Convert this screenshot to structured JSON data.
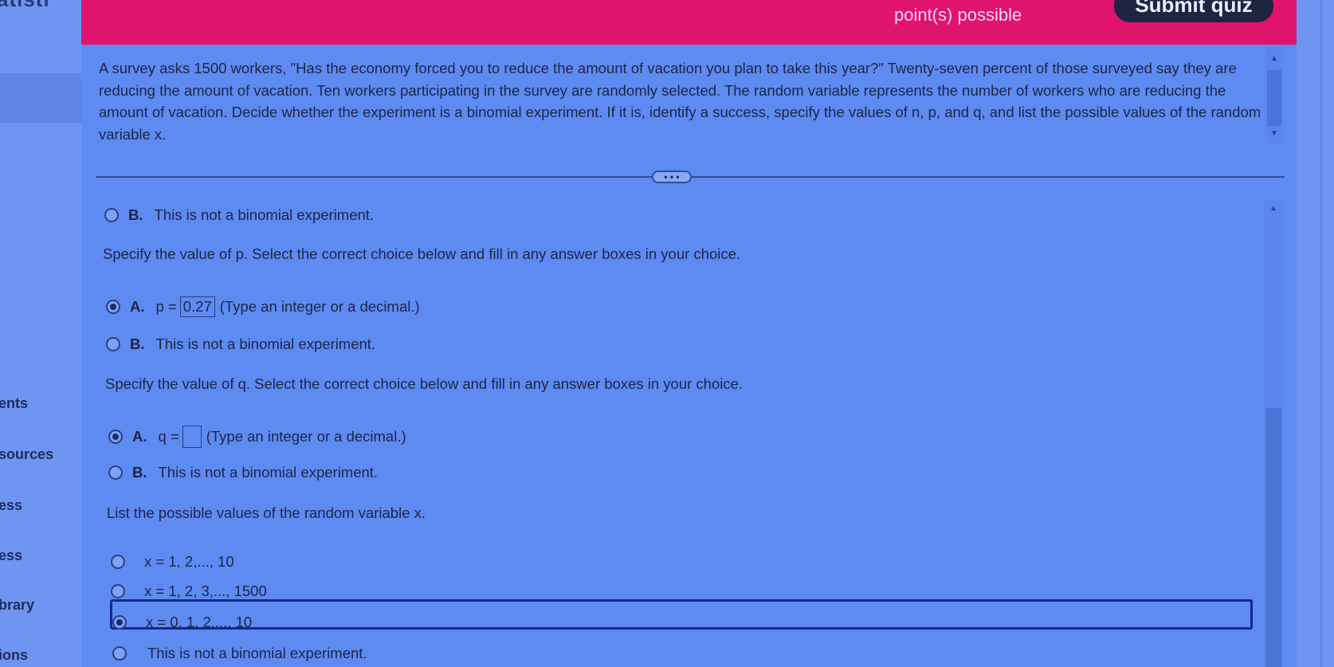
{
  "sidebar": {
    "top_text": "atistr",
    "items": [
      "ents",
      "sources",
      "ess",
      "ess",
      "brary",
      "ions"
    ]
  },
  "header": {
    "points_label": "point(s) possible",
    "submit_label": "Submit quiz"
  },
  "question": {
    "text": "A survey asks 1500 workers, \"Has the economy forced you to reduce the amount of vacation you plan to take this year?\" Twenty-seven percent of those surveyed say they are reducing the amount of vacation. Ten workers participating in the survey are randomly selected. The random variable represents the number of workers who are reducing the amount of vacation. Decide whether the experiment is a binomial experiment. If it is, identify a success, specify the values of n, p, and q, and list the possible values of the random variable x."
  },
  "divider_label": "• • •",
  "options": {
    "n_b_letter": "B.",
    "n_b_text": "This is not a binomial experiment.",
    "p_instruction": "Specify the value of p. Select the correct choice below and fill in any answer boxes in your choice.",
    "p_a_letter": "A.",
    "p_a_prefix": "p =",
    "p_a_value": "0.27",
    "p_a_hint": "(Type an integer or a decimal.)",
    "p_b_letter": "B.",
    "p_b_text": "This is not a binomial experiment.",
    "q_instruction": "Specify the value of q. Select the correct choice below and fill in any answer boxes in your choice.",
    "q_a_letter": "A.",
    "q_a_prefix": "q =",
    "q_a_value": "",
    "q_a_hint": "(Type an integer or a decimal.)",
    "q_b_letter": "B.",
    "q_b_text": "This is not a binomial experiment.",
    "x_instruction": "List the possible values of the random variable x.",
    "x_choices": [
      "x = 1, 2,..., 10",
      "x = 1, 2, 3,..., 1500",
      "x = 0, 1, 2,..., 10",
      "This is not a binomial experiment."
    ]
  },
  "colors": {
    "header": "#e0136f",
    "background": "#5e8bf2",
    "selected_outline": "#16278a"
  }
}
